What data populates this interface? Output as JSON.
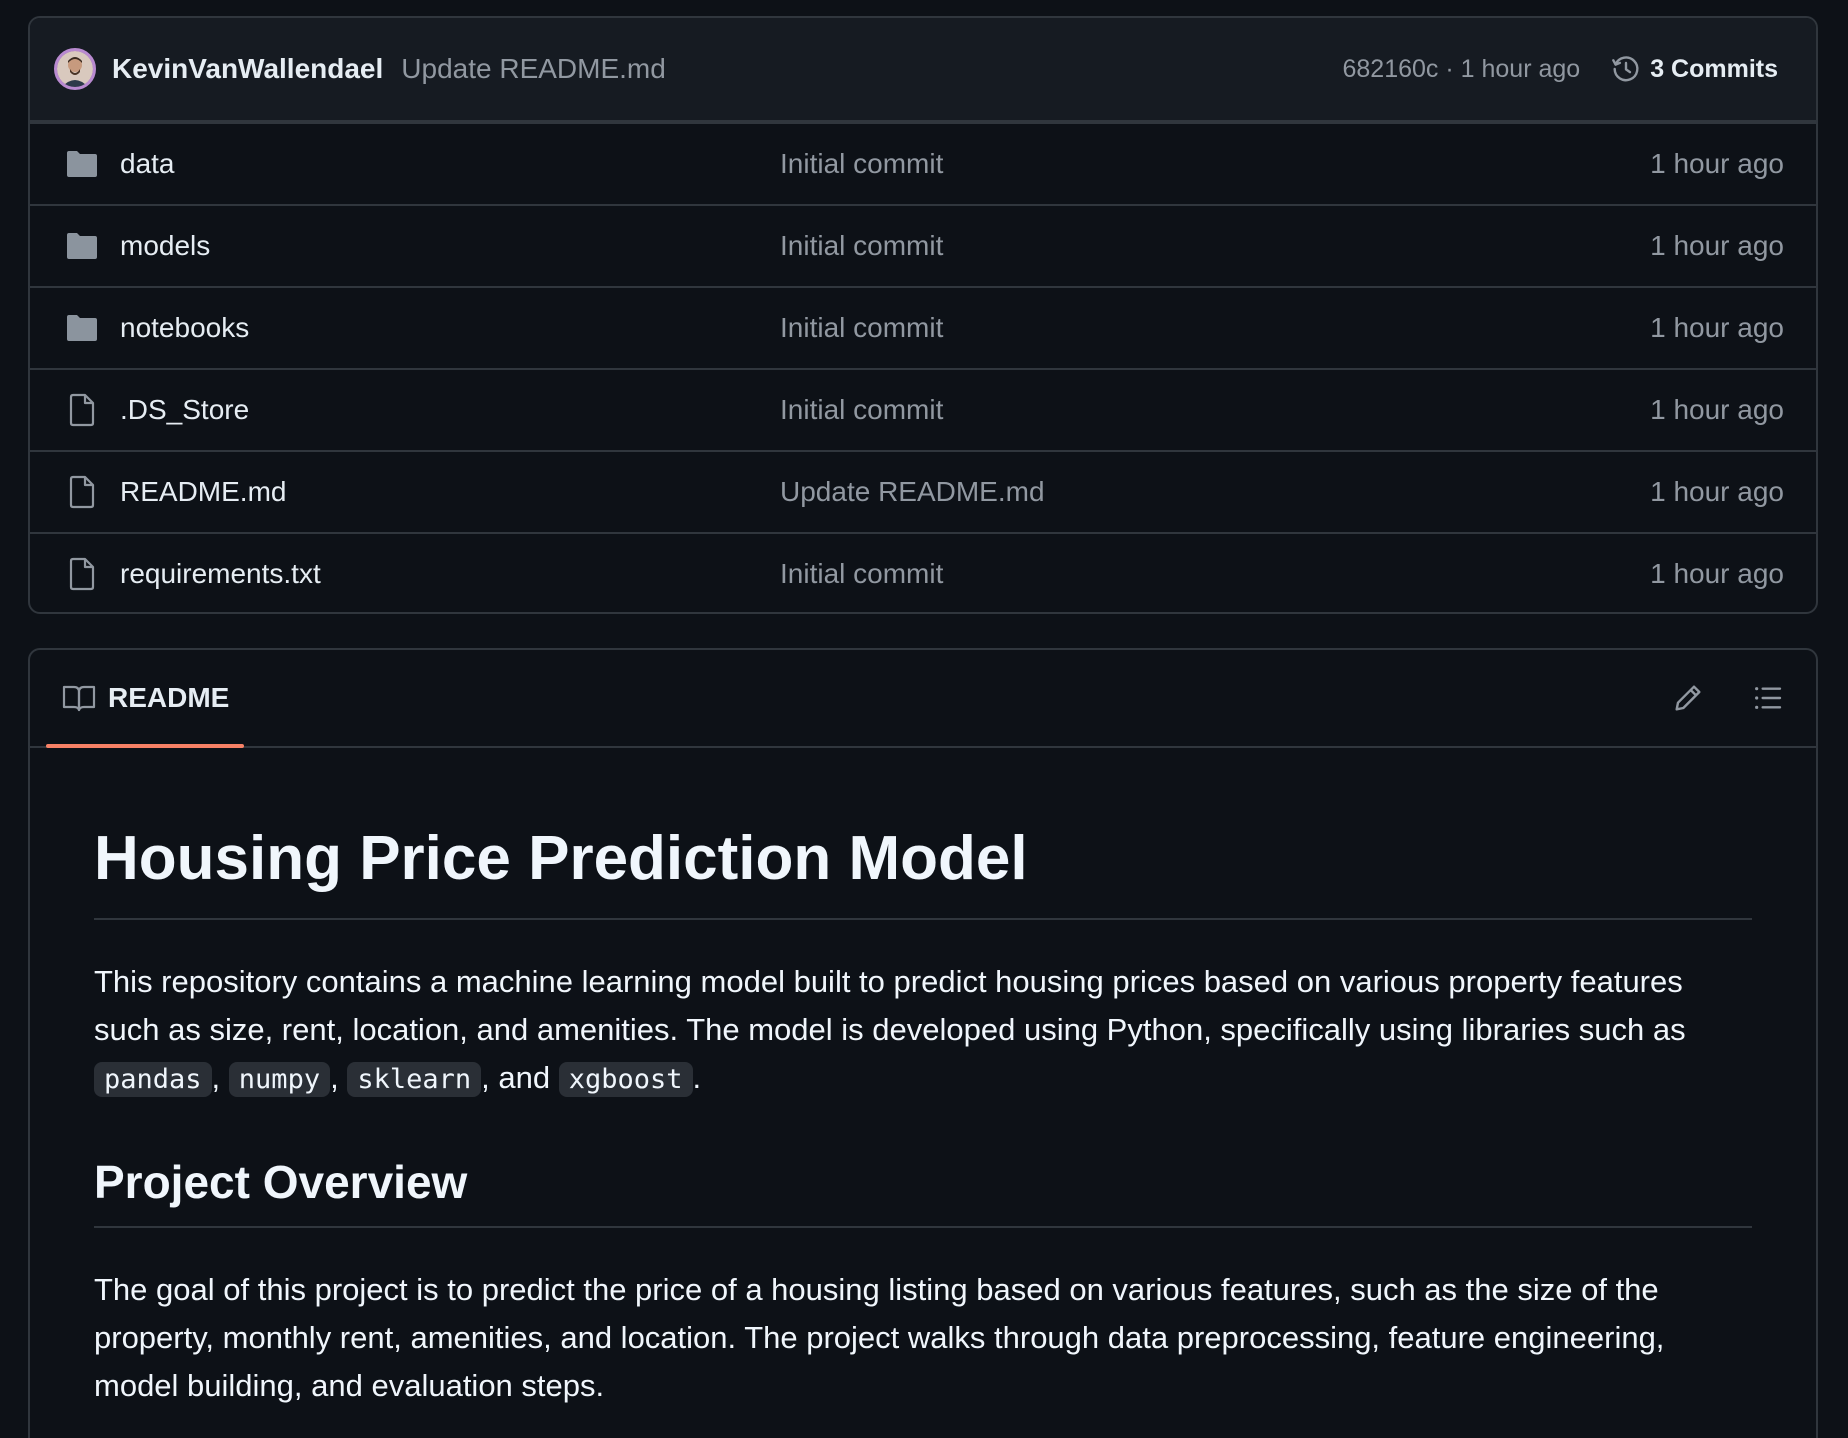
{
  "latest_commit": {
    "author": "KevinVanWallendael",
    "message": "Update README.md",
    "meta": "682160c · 1 hour ago",
    "commits_label": "3 Commits"
  },
  "files": [
    {
      "name": "data",
      "type": "folder",
      "commit": "Initial commit",
      "time": "1 hour ago"
    },
    {
      "name": "models",
      "type": "folder",
      "commit": "Initial commit",
      "time": "1 hour ago"
    },
    {
      "name": "notebooks",
      "type": "folder",
      "commit": "Initial commit",
      "time": "1 hour ago"
    },
    {
      "name": ".DS_Store",
      "type": "file",
      "commit": "Initial commit",
      "time": "1 hour ago"
    },
    {
      "name": "README.md",
      "type": "file",
      "commit": "Update README.md",
      "time": "1 hour ago"
    },
    {
      "name": "requirements.txt",
      "type": "file",
      "commit": "Initial commit",
      "time": "1 hour ago"
    }
  ],
  "readme": {
    "tab_label": "README",
    "title": "Housing Price Prediction Model",
    "intro_prefix": "This repository contains a machine learning model built to predict housing prices based on various property features such as size, rent, location, and amenities. The model is developed using Python, specifically using libraries such as ",
    "libraries": [
      "pandas",
      "numpy",
      "sklearn",
      "xgboost"
    ],
    "sep_comma": ",",
    "sep_and": ", and",
    "end_period": ".",
    "overview_heading": "Project Overview",
    "overview_text": "The goal of this project is to predict the price of a housing listing based on various features, such as the size of the property, monthly rent, amenities, and location. The project walks through data preprocessing, feature engineering, model building, and evaluation steps."
  },
  "colors": {
    "background": "#0d1117",
    "border": "#30363d",
    "muted_text": "#9198a1",
    "active_tab_underline": "#f78166",
    "folder_icon": "#8b949e"
  },
  "icons": {
    "avatar": "user-avatar",
    "history": "history-icon",
    "folder": "folder-icon",
    "file": "file-icon",
    "book": "book-icon",
    "edit": "pencil-icon",
    "outline": "list-icon"
  }
}
